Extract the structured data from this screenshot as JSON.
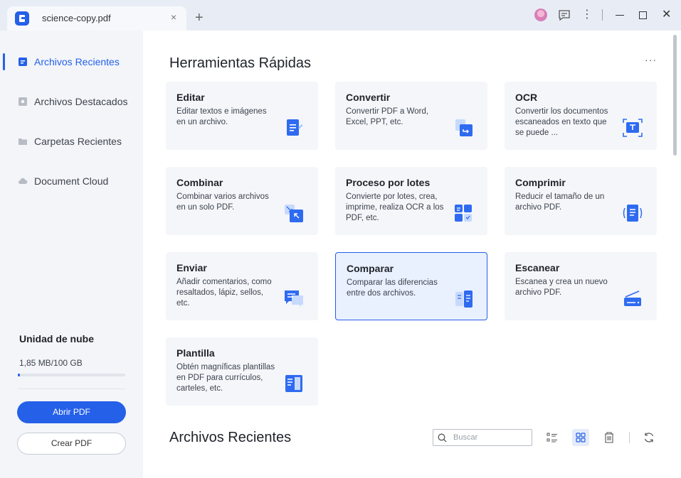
{
  "window": {
    "tab_title": "science-copy.pdf",
    "tab_close": "×",
    "tab_add": "+",
    "more": "⋮",
    "close": "✕"
  },
  "sidebar": {
    "items": [
      {
        "label": "Archivos Recientes",
        "active": true,
        "icon": "recent-files-icon"
      },
      {
        "label": "Archivos Destacados",
        "active": false,
        "icon": "star-icon"
      },
      {
        "label": "Carpetas Recientes",
        "active": false,
        "icon": "folder-icon"
      },
      {
        "label": "Document Cloud",
        "active": false,
        "icon": "cloud-icon"
      }
    ],
    "storage": {
      "title": "Unidad de nube",
      "value": "1,85 MB/100 GB",
      "fraction": 0.0185
    },
    "open_button": "Abrir PDF",
    "create_button": "Crear PDF"
  },
  "main": {
    "quick_tools_title": "Herramientas Rápidas",
    "more_label": "···",
    "tools": [
      {
        "title": "Editar",
        "desc": "Editar textos e imágenes en un archivo.",
        "icon": "edit-icon"
      },
      {
        "title": "Convertir",
        "desc": "Convertir PDF a Word, Excel, PPT, etc.",
        "icon": "convert-icon"
      },
      {
        "title": "OCR",
        "desc": "Convertir los documentos escaneados en texto que se puede ...",
        "icon": "ocr-icon"
      },
      {
        "title": "Combinar",
        "desc": "Combinar varios archivos en un solo PDF.",
        "icon": "combine-icon"
      },
      {
        "title": "Proceso por lotes",
        "desc": "Convierte por lotes, crea, imprime, realiza OCR a los PDF, etc.",
        "icon": "batch-icon"
      },
      {
        "title": "Comprimir",
        "desc": "Reducir el tamaño de un archivo PDF.",
        "icon": "compress-icon"
      },
      {
        "title": "Enviar",
        "desc": "Añadir comentarios, como resaltados, lápiz, sellos, etc.",
        "icon": "comment-icon"
      },
      {
        "title": "Comparar",
        "desc": "Comparar las diferencias entre dos archivos.",
        "icon": "compare-icon"
      },
      {
        "title": "Escanear",
        "desc": "Escanea y crea un nuevo archivo PDF.",
        "icon": "scan-icon"
      },
      {
        "title": "Plantilla",
        "desc": "Obtén magníficas plantillas en PDF para currículos, carteles, etc.",
        "icon": "template-icon"
      }
    ],
    "recent_title": "Archivos Recientes",
    "search": {
      "placeholder": "Buscar",
      "value": ""
    }
  },
  "colors": {
    "accent": "#2560e8",
    "card_bg": "#f4f6fa",
    "selected_bg": "#e9f0fe"
  }
}
